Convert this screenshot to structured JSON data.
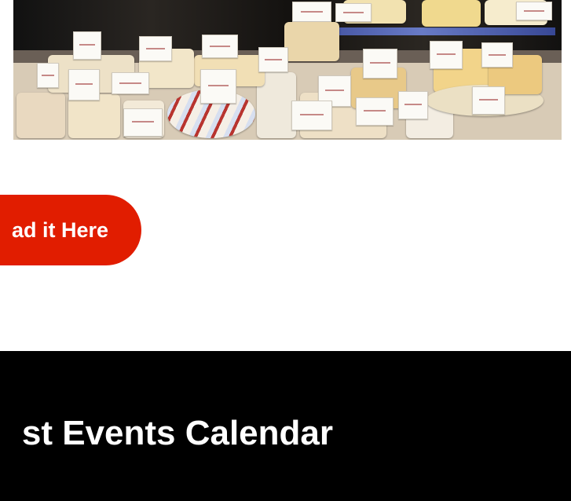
{
  "hero": {
    "image_alt": "cheese display case"
  },
  "cta": {
    "label": "ad it Here",
    "color": "#e11d00",
    "text_color": "#ffffff"
  },
  "events": {
    "title": "st Events Calendar",
    "background": "#000000"
  }
}
